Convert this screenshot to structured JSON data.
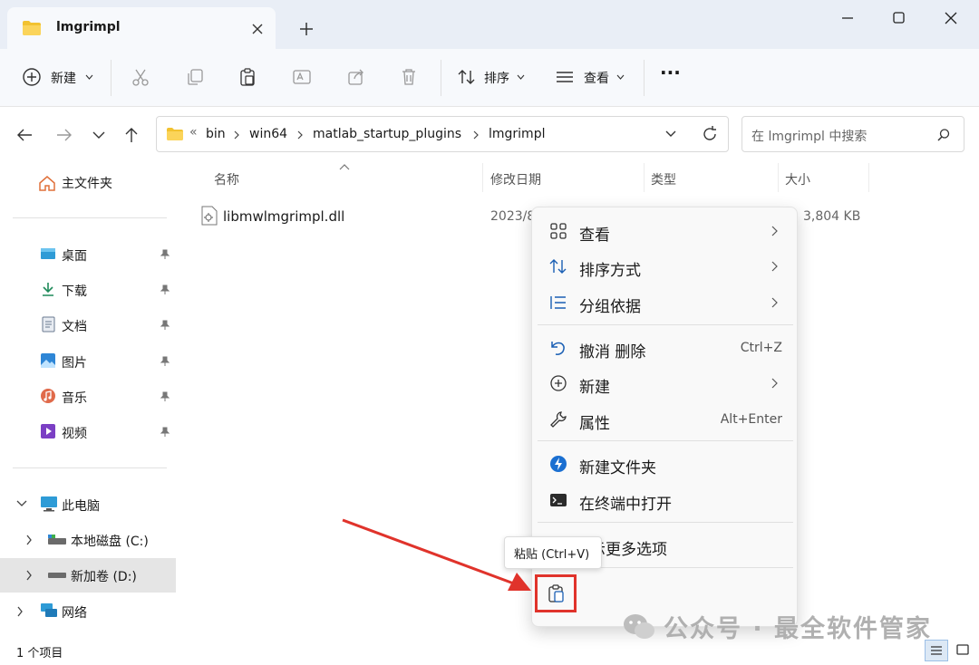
{
  "window": {
    "tab_title": "lmgrimpl",
    "tab_close_icon": "close-icon",
    "new_tab_icon": "plus-icon",
    "controls": [
      "minimize-icon",
      "maximize-icon",
      "close-icon"
    ]
  },
  "toolbar": {
    "new_label": "新建",
    "sort_label": "排序",
    "view_label": "查看",
    "more_label": "···",
    "icons": [
      "cut-icon",
      "copy-icon",
      "paste-icon",
      "rename-icon",
      "share-icon",
      "delete-icon"
    ]
  },
  "address": {
    "overflow": "«",
    "crumbs": [
      "bin",
      "win64",
      "matlab_startup_plugins",
      "lmgrimpl"
    ],
    "search_placeholder": "在 lmgrimpl 中搜索"
  },
  "sidebar": {
    "home": "主文件夹",
    "quick": [
      {
        "label": "桌面",
        "icon": "desktop-icon"
      },
      {
        "label": "下载",
        "icon": "download-icon"
      },
      {
        "label": "文档",
        "icon": "document-icon"
      },
      {
        "label": "图片",
        "icon": "picture-icon"
      },
      {
        "label": "音乐",
        "icon": "music-icon"
      },
      {
        "label": "视频",
        "icon": "video-icon"
      }
    ],
    "this_pc": "此电脑",
    "drives": [
      "本地磁盘 (C:)",
      "新加卷 (D:)"
    ],
    "network": "网络"
  },
  "columns": {
    "name": "名称",
    "modified": "修改日期",
    "type": "类型",
    "size": "大小"
  },
  "files": [
    {
      "name": "libmwlmgrimpl.dll",
      "modified": "2023/8",
      "size": "3,804 KB"
    }
  ],
  "context_menu": {
    "items": [
      {
        "label": "查看",
        "icon": "grid-icon",
        "submenu": true
      },
      {
        "label": "排序方式",
        "icon": "sort-icon",
        "submenu": true
      },
      {
        "label": "分组依据",
        "icon": "group-icon",
        "submenu": true
      },
      {
        "label": "撤消 删除",
        "icon": "undo-icon",
        "shortcut": "Ctrl+Z"
      },
      {
        "label": "新建",
        "icon": "plus-circle-icon",
        "submenu": true
      },
      {
        "label": "属性",
        "icon": "wrench-icon",
        "shortcut": "Alt+Enter"
      },
      {
        "label": "新建文件夹",
        "icon": "lightning-icon"
      },
      {
        "label": "在终端中打开",
        "icon": "terminal-icon"
      },
      {
        "label": "示更多选项",
        "icon": "more-options-icon"
      }
    ],
    "tooltip": "粘贴 (Ctrl+V)"
  },
  "status": {
    "count": "1 个项目"
  },
  "watermark": "公众号 · 最全软件管家"
}
